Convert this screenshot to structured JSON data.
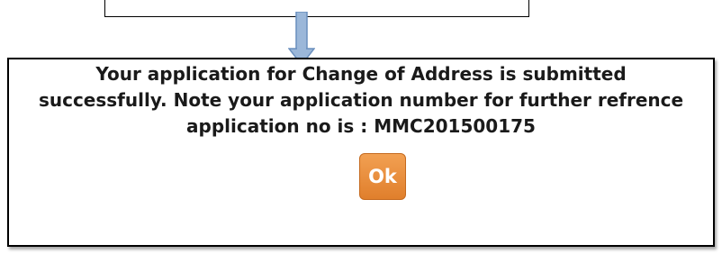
{
  "dialog": {
    "message_lines": [
      "Your application for Change of Address is submitted",
      "successfully. Note your application number for further refrence",
      "application no is : MMC201500175"
    ],
    "ok_label": "Ok"
  },
  "colors": {
    "ok_button": "#e9893a",
    "arrow": "#9bb7d9",
    "border": "#000000"
  },
  "icons": {
    "arrow": "down-arrow-icon"
  }
}
